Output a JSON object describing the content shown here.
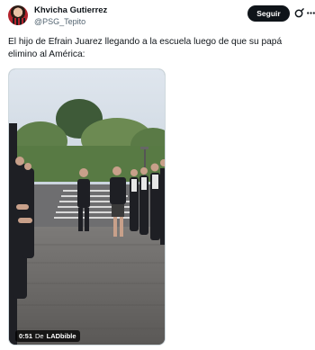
{
  "author": {
    "name": "Khvicha Gutierrez",
    "handle": "@PSG_Tepito"
  },
  "actions": {
    "follow_label": "Seguir"
  },
  "tweet": {
    "text": "El hijo de Efrain Juarez llegando a la escuela luego de que su papá elimino al América:"
  },
  "video": {
    "duration": "0:51",
    "from_label": "De",
    "source": "LADbible"
  },
  "icons": {
    "grok": "grok-icon",
    "more": "more-options-icon"
  },
  "colors": {
    "follow_button": "#0f1419",
    "handle": "#536471"
  }
}
